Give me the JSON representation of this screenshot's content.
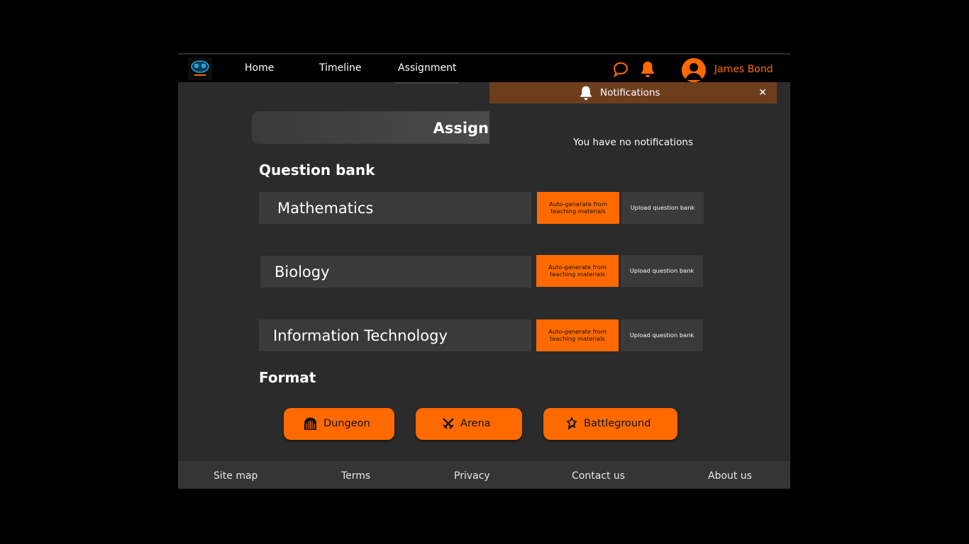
{
  "nav": {
    "items": [
      {
        "label": "Home"
      },
      {
        "label": "Timeline"
      },
      {
        "label": "Assignment"
      }
    ],
    "active": "Assignment"
  },
  "user": {
    "name": "James Bond"
  },
  "colors": {
    "accent": "#ff6a00",
    "notification_header": "#6d3e1e",
    "panel": "#2b2b2b",
    "row": "#3a3a3a"
  },
  "icons": {
    "chat": "chat-bubble-icon",
    "bell": "bell-icon",
    "avatar": "user-avatar-icon",
    "close": "close-icon"
  },
  "notifications": {
    "title": "Notifications",
    "close": "✕",
    "empty": "You have no notifications"
  },
  "page": {
    "title": "Assign"
  },
  "question_bank": {
    "title": "Question bank",
    "subjects": [
      {
        "name": "Mathematics",
        "auto_label": "Auto-generate from teaching materials",
        "upload_label": "Upload question bank"
      },
      {
        "name": "Biology",
        "auto_label": "Auto-generate from teaching materials",
        "upload_label": "Upload question bank"
      },
      {
        "name": "Information Technology",
        "auto_label": "Auto-generate from teaching materials",
        "upload_label": "Upload question bank"
      }
    ]
  },
  "format": {
    "title": "Format",
    "options": [
      {
        "label": "Dungeon",
        "icon": "dungeon-gate-icon"
      },
      {
        "label": "Arena",
        "icon": "crossed-swords-icon"
      },
      {
        "label": "Battleground",
        "icon": "battleground-icon"
      }
    ]
  },
  "footer": {
    "links": [
      "Site map",
      "Terms",
      "Privacy",
      "Contact us",
      "About us"
    ]
  }
}
